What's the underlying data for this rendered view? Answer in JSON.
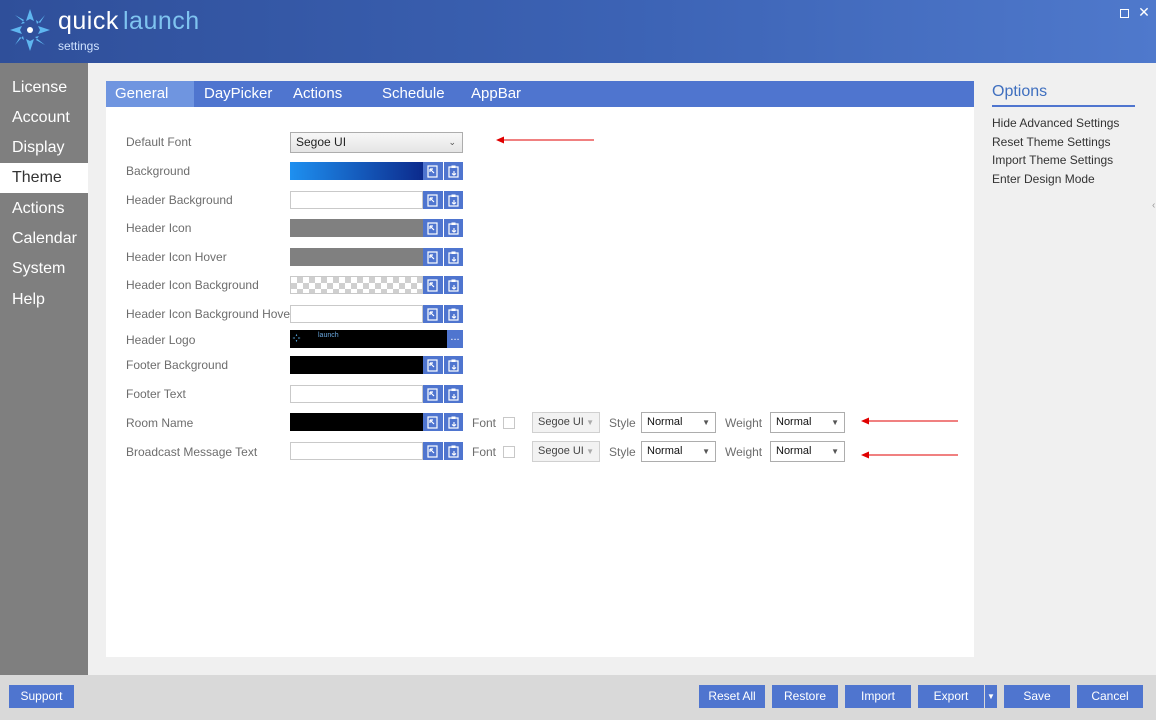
{
  "app": {
    "name_primary": "quick",
    "name_secondary": "launch",
    "subtitle": "settings"
  },
  "window": {
    "maximize_icon": "maximize-icon",
    "close_icon": "close-icon",
    "close_glyph": "✕"
  },
  "sidebar": {
    "items": [
      {
        "label": "License"
      },
      {
        "label": "Account"
      },
      {
        "label": "Display"
      },
      {
        "label": "Theme",
        "active": true
      },
      {
        "label": "Actions"
      },
      {
        "label": "Calendar"
      },
      {
        "label": "System"
      },
      {
        "label": "Help"
      }
    ]
  },
  "tabs": [
    {
      "label": "General",
      "active": true
    },
    {
      "label": "DayPicker"
    },
    {
      "label": "Actions"
    },
    {
      "label": "Schedule"
    },
    {
      "label": "AppBar"
    }
  ],
  "form": {
    "default_font": {
      "label": "Default Font",
      "value": "Segoe UI"
    },
    "rows": [
      {
        "label": "Background"
      },
      {
        "label": "Header Background"
      },
      {
        "label": "Header Icon"
      },
      {
        "label": "Header Icon Hover"
      },
      {
        "label": "Header Icon Background"
      },
      {
        "label": "Header Icon Background Hover"
      },
      {
        "label": "Header Logo",
        "logo_text": "launch",
        "browse_label": "..."
      },
      {
        "label": "Footer Background"
      },
      {
        "label": "Footer Text"
      },
      {
        "label": "Room Name"
      },
      {
        "label": "Broadcast Message Text"
      }
    ],
    "text_options": {
      "font_label": "Font",
      "font_value": "Segoe UI",
      "style_label": "Style",
      "style_value": "Normal",
      "weight_label": "Weight",
      "weight_value": "Normal"
    },
    "colors": {
      "background_start": "#1e90f0",
      "background_end": "#0c2a8c",
      "header_icon": "#808080",
      "header_icon_hover": "#808080",
      "header_logo_bg": "#000000",
      "footer_background": "#000000",
      "room_name": "#000000"
    }
  },
  "options": {
    "title": "Options",
    "links": [
      {
        "label": "Hide Advanced Settings"
      },
      {
        "label": "Reset Theme Settings"
      },
      {
        "label": "Import Theme Settings"
      },
      {
        "label": "Enter Design Mode"
      }
    ]
  },
  "footer": {
    "support": "Support",
    "reset_all": "Reset All",
    "restore": "Restore",
    "import": "Import",
    "export": "Export",
    "save": "Save",
    "cancel": "Cancel"
  },
  "accent_color": "#4f75cf",
  "annotation_color": "#e00000"
}
